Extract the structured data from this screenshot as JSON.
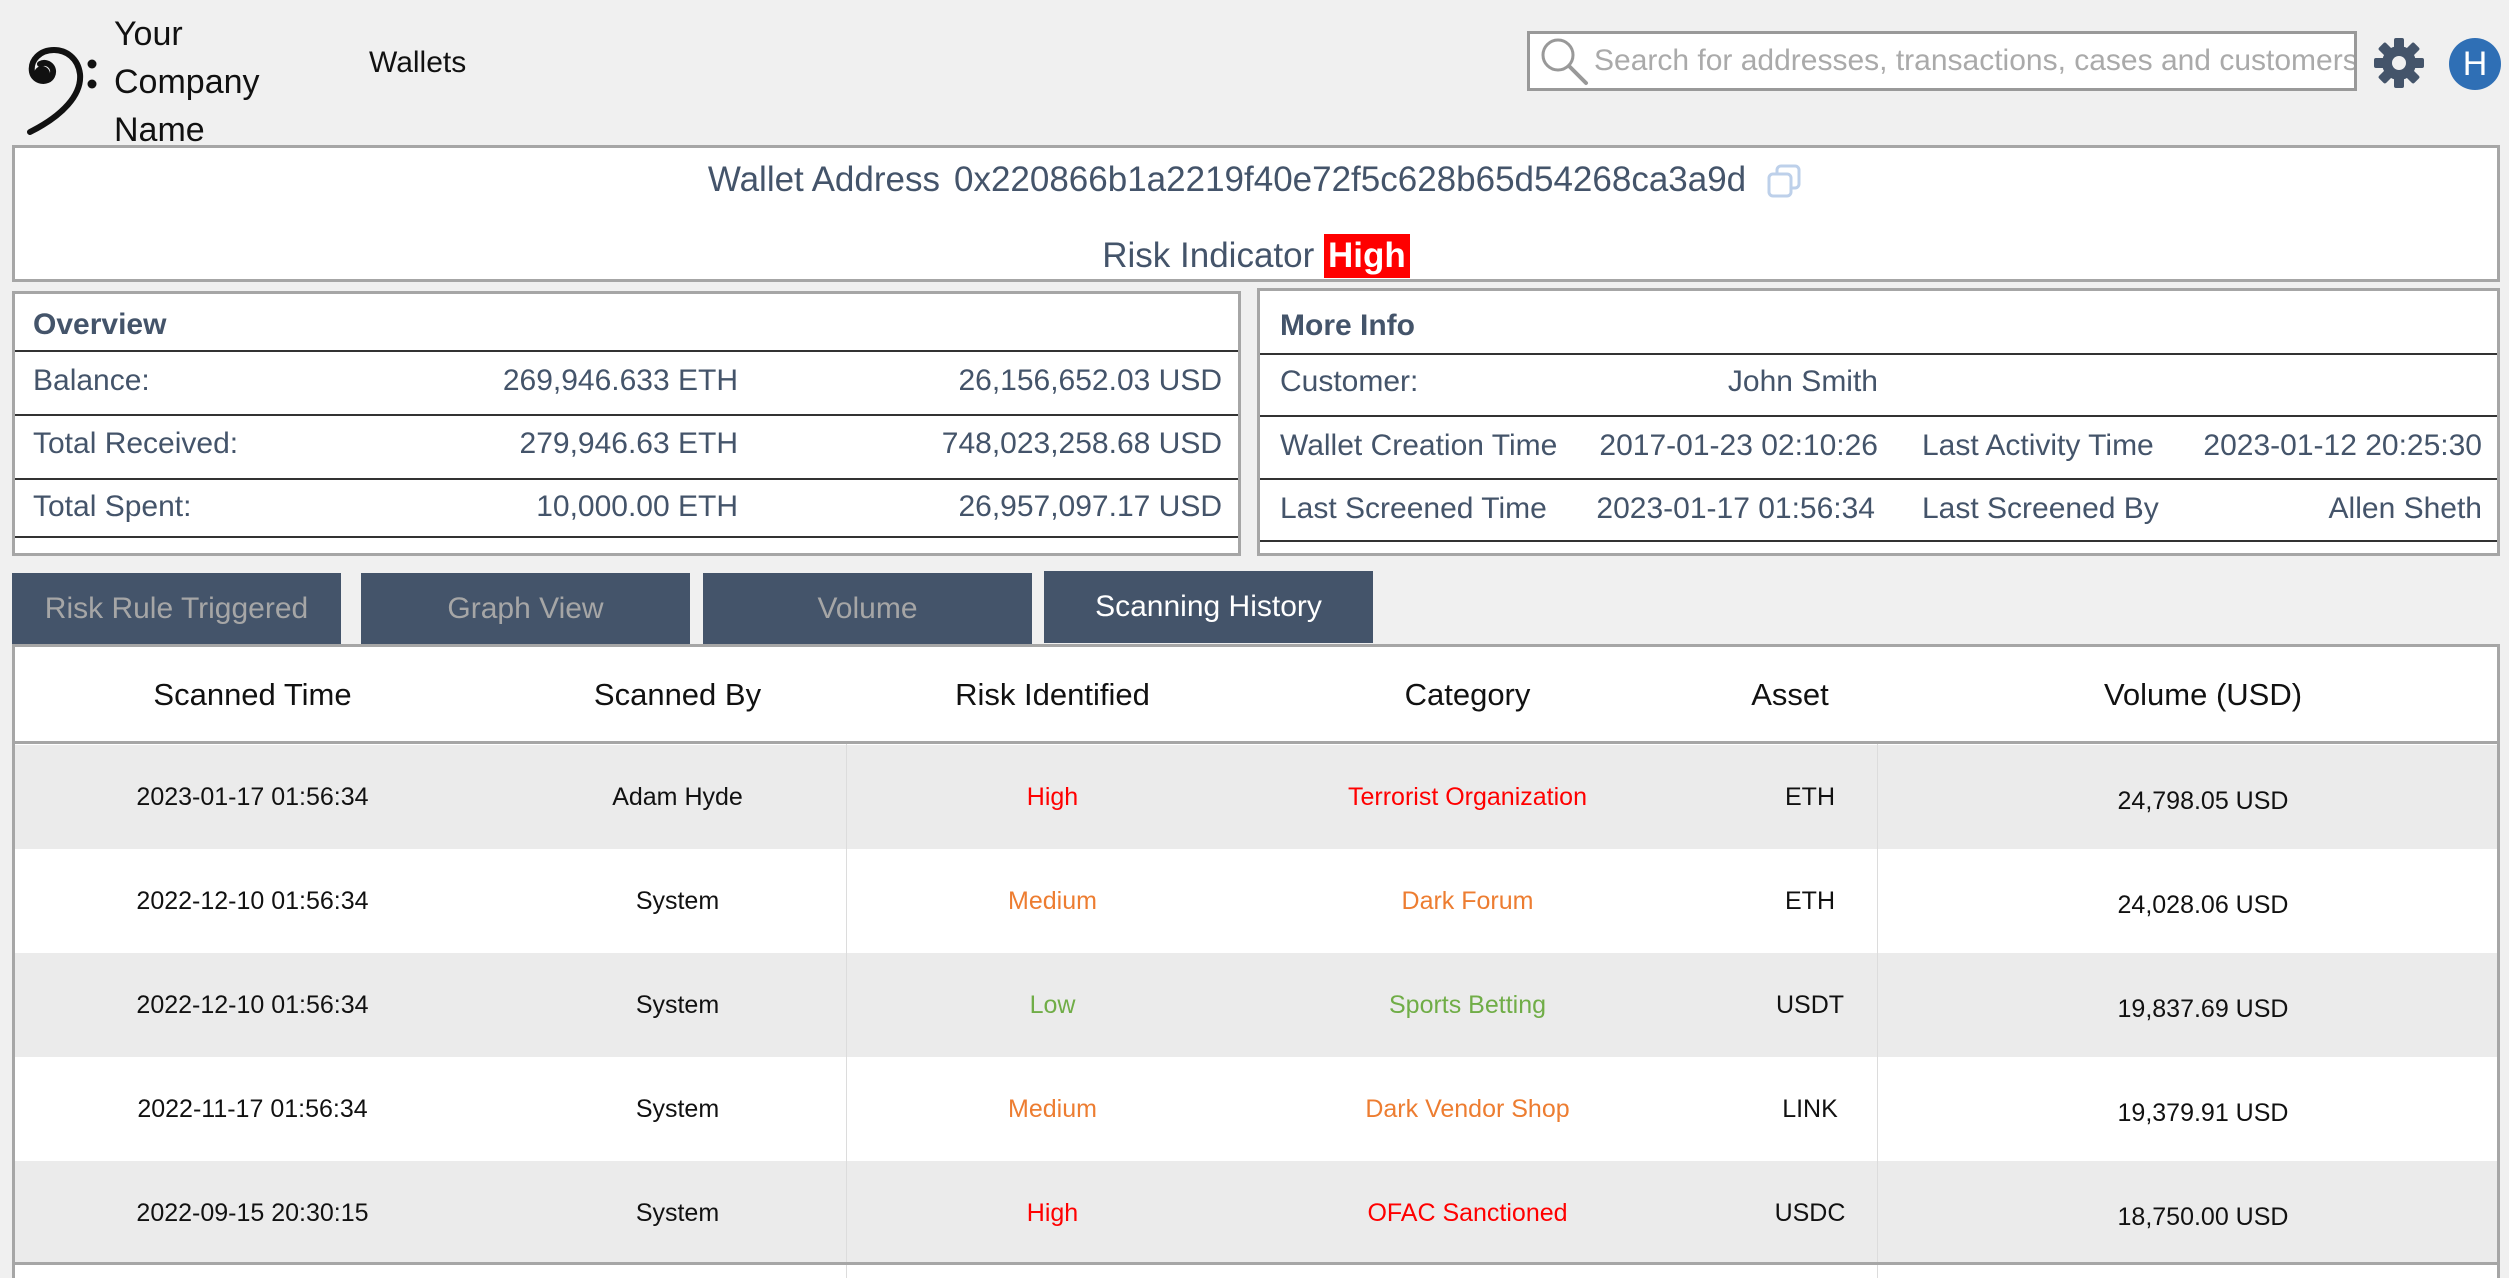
{
  "header": {
    "company_name": "Your Company Name",
    "nav_wallets": "Wallets",
    "search_placeholder": "Search for addresses, transactions, cases and customers...",
    "avatar_initial": "H"
  },
  "wallet": {
    "address_label": "Wallet Address",
    "address": "0x220866b1a2219f40e72f5c628b65d54268ca3a9d",
    "risk_label": "Risk Indicator",
    "risk_value": "High"
  },
  "overview": {
    "title": "Overview",
    "rows": [
      {
        "label": "Balance:",
        "eth": "269,946.633 ETH",
        "usd": "26,156,652.03 USD"
      },
      {
        "label": "Total Received:",
        "eth": "279,946.63 ETH",
        "usd": "748,023,258.68 USD"
      },
      {
        "label": "Total Spent:",
        "eth": "10,000.00 ETH",
        "usd": "26,957,097.17 USD"
      }
    ]
  },
  "more_info": {
    "title": "More Info",
    "customer_label": "Customer:",
    "customer_value": "John Smith",
    "creation_label": "Wallet Creation Time",
    "creation_value": "2017-01-23 02:10:26",
    "activity_label": "Last Activity Time",
    "activity_value": "2023-01-12 20:25:30",
    "screened_time_label": "Last Screened Time",
    "screened_time_value": "2023-01-17 01:56:34",
    "screened_by_label": "Last Screened By",
    "screened_by_value": "Allen Sheth"
  },
  "tabs": [
    {
      "label": "Risk Rule Triggered",
      "active": false
    },
    {
      "label": "Graph View",
      "active": false
    },
    {
      "label": "Volume",
      "active": false
    },
    {
      "label": "Scanning History",
      "active": true
    }
  ],
  "table": {
    "headers": [
      "Scanned Time",
      "Scanned By",
      "Risk Identified",
      "Category",
      "Asset",
      "Volume (USD)"
    ],
    "rows": [
      {
        "time": "2023-01-17 01:56:34",
        "by": "Adam Hyde",
        "risk": "High",
        "category": "Terrorist Organization",
        "asset": "ETH",
        "volume": "24,798.05 USD",
        "risk_color": "#ff0000"
      },
      {
        "time": "2022-12-10 01:56:34",
        "by": "System",
        "risk": "Medium",
        "category": "Dark Forum",
        "asset": "ETH",
        "volume": "24,028.06 USD",
        "risk_color": "#ed7d31"
      },
      {
        "time": "2022-12-10 01:56:34",
        "by": "System",
        "risk": "Low",
        "category": "Sports Betting",
        "asset": "USDT",
        "volume": "19,837.69 USD",
        "risk_color": "#70ad47"
      },
      {
        "time": "2022-11-17 01:56:34",
        "by": "System",
        "risk": "Medium",
        "category": "Dark Vendor Shop",
        "asset": "LINK",
        "volume": "19,379.91 USD",
        "risk_color": "#ed7d31"
      },
      {
        "time": "2022-09-15 20:30:15",
        "by": "System",
        "risk": "High",
        "category": "OFAC Sanctioned",
        "asset": "USDC",
        "volume": "18,750.00 USD",
        "risk_color": "#ff0000"
      }
    ]
  },
  "colors": {
    "tab_bg": "#44546a",
    "text_primary": "#44546a",
    "risk_high": "#ff0000",
    "risk_medium": "#ed7d31",
    "risk_low": "#70ad47",
    "accent_blue": "#2f6fb5"
  },
  "icons": [
    "bass-clef-logo-icon",
    "search-icon",
    "gear-icon",
    "copy-icon"
  ]
}
